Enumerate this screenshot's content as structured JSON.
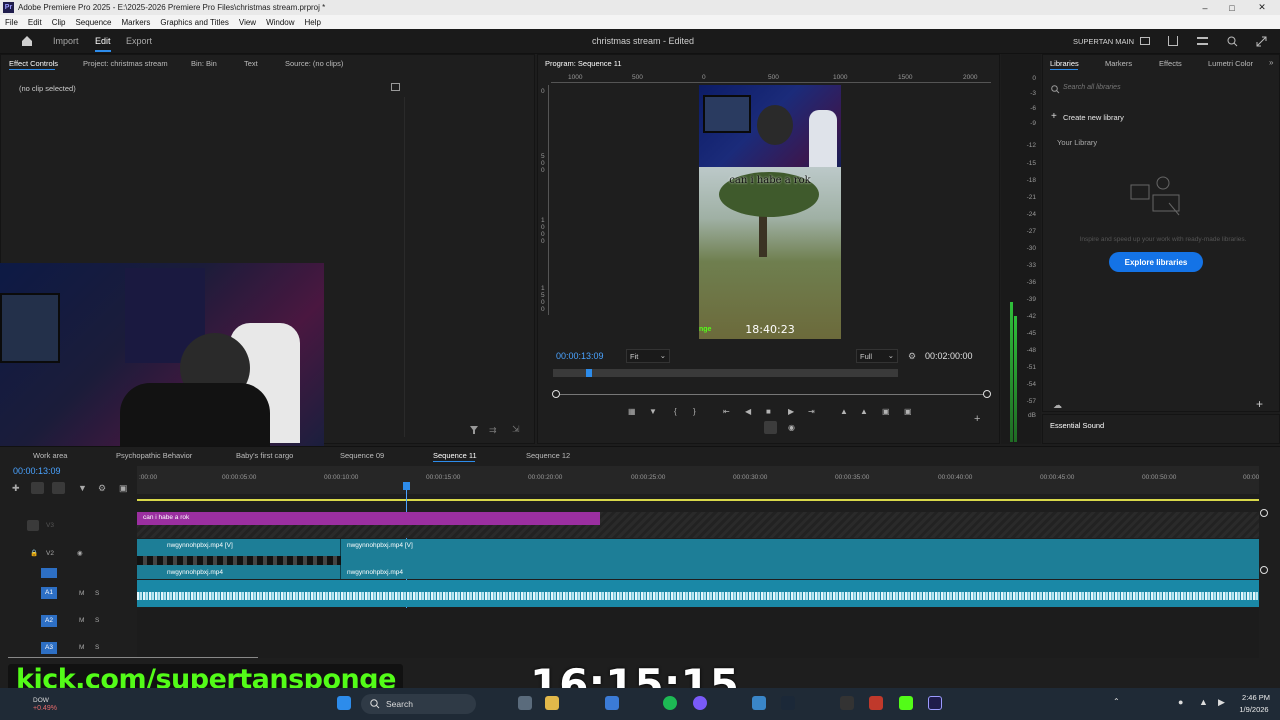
{
  "app": {
    "title": "Adobe Premiere Pro 2025 - E:\\2025-2026 Premiere Pro Files\\christmas stream.prproj *",
    "logo": "Pr",
    "project_title": "christmas stream - Edited",
    "workspace": "SUPERTAN MAIN"
  },
  "menu": [
    "File",
    "Edit",
    "Clip",
    "Sequence",
    "Markers",
    "Graphics and Titles",
    "View",
    "Window",
    "Help"
  ],
  "appbar": {
    "import": "Import",
    "edit": "Edit",
    "export": "Export"
  },
  "source_panel": {
    "tabs": [
      "Effect Controls",
      "Project: christmas stream",
      "Bin: Bin",
      "Text",
      "Source: (no clips)"
    ],
    "no_clip": "(no clip selected)"
  },
  "program": {
    "title": "Program: Sequence 11",
    "ruler_top": [
      "1000",
      "500",
      "0",
      "500",
      "1000",
      "1500",
      "2000"
    ],
    "ruler_left": [
      "0",
      "5\n0\n0",
      "1\n0\n0\n0",
      "1\n5\n0\n0"
    ],
    "caption": "can i habe a rok",
    "clock": "18:40:23",
    "badge": "nge",
    "timecode": "00:00:13:09",
    "fit": "Fit",
    "full": "Full",
    "duration": "00:02:00:00"
  },
  "meter": [
    "0",
    "-3",
    "-6",
    "-9",
    "-12",
    "-15",
    "-18",
    "-21",
    "-24",
    "-27",
    "-30",
    "-33",
    "-36",
    "-39",
    "-42",
    "-45",
    "-48",
    "-51",
    "-54",
    "-57",
    "dB"
  ],
  "libraries": {
    "tabs": [
      "Libraries",
      "Markers",
      "Effects",
      "Lumetri Color"
    ],
    "search_placeholder": "Search all libraries",
    "create": "Create new library",
    "your_library": "Your Library",
    "inspire": "Inspire and speed up your work with ready-made libraries.",
    "explore": "Explore libraries",
    "essential_sound": "Essential Sound"
  },
  "timeline": {
    "tabs": [
      "Work area",
      "Psychopathic Behavior",
      "Baby's first cargo",
      "Sequence 09",
      "Sequence 11",
      "Sequence 12"
    ],
    "timecode": "00:00:13:09",
    "ruler": [
      ":00:00",
      "00:00:05:00",
      "00:00:10:00",
      "00:00:15:00",
      "00:00:20:00",
      "00:00:25:00",
      "00:00:30:00",
      "00:00:35:00",
      "00:00:40:00",
      "00:00:45:00",
      "00:00:50:00",
      "00:00"
    ],
    "tracks_video": [
      "V3",
      "V2"
    ],
    "tracks_audio": [
      "A1",
      "A2",
      "A3"
    ],
    "text_clip": "can i habe a rok",
    "video_clip_a": "nwgynnohpbxj.mp4 [V]",
    "video_clip_b": "nwgynnohpbxj.mp4 [V]",
    "audio_clip_a": "nwgynnohpbxj.mp4",
    "audio_clip_b": "nwgynnohpbxj.mp4",
    "mute": "M",
    "solo": "S"
  },
  "overlay": {
    "kick": "kick.com/supertansponge",
    "stream_clock": "16:15:15",
    "stock_delta": "+0.49%",
    "stock_name": "DOW"
  },
  "taskbar": {
    "search": "Search",
    "time": "2:46 PM",
    "date": "1/9/2026"
  },
  "colors": {
    "accent": "#2d8ceb",
    "timecode": "#4aa3ff",
    "text_clip": "#9b2fa0",
    "video_clip": "#1d7e97",
    "audio_clip": "#1a88a6",
    "meter_green": "#2fbf3a",
    "kick_green": "#53fc18"
  }
}
